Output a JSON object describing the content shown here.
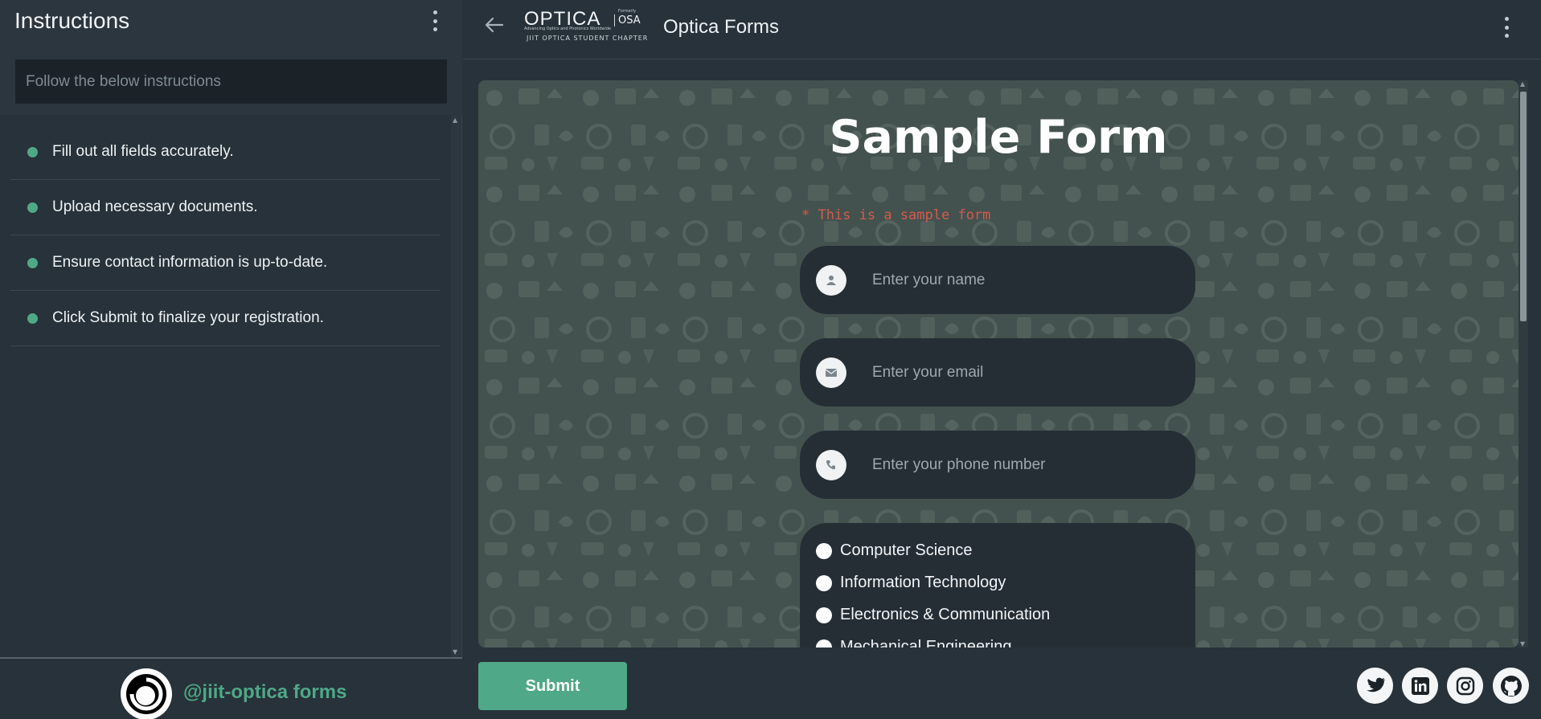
{
  "sidebar": {
    "title": "Instructions",
    "search_placeholder": "Follow the below instructions",
    "items": [
      {
        "label": "Fill out all fields accurately."
      },
      {
        "label": "Upload necessary documents."
      },
      {
        "label": "Ensure contact information is up-to-date."
      },
      {
        "label": "Click Submit to finalize your registration."
      }
    ],
    "footer_handle": "@jiit-optica forms"
  },
  "header": {
    "logo_text": "OPTICA",
    "logo_osa": "OSA",
    "logo_formerly": "Formerly",
    "logo_tagline": "Advancing Optics and Photonics Worldwide",
    "logo_chapter": "JIIT OPTICA STUDENT CHAPTER",
    "app_title": "Optica Forms"
  },
  "form": {
    "title": "Sample Form",
    "note": "* This is a sample form",
    "name_placeholder": "Enter your name",
    "email_placeholder": "Enter your email",
    "phone_placeholder": "Enter your phone number",
    "branches": [
      "Computer Science",
      "Information Technology",
      "Electronics & Communication",
      "Mechanical Engineering"
    ],
    "submit_label": "Submit"
  },
  "social": [
    "twitter-icon",
    "linkedin-icon",
    "instagram-icon",
    "github-icon"
  ],
  "colors": {
    "accent": "#4fa887",
    "note": "#d45a4e",
    "panel": "#27323a",
    "field": "#252e35"
  }
}
